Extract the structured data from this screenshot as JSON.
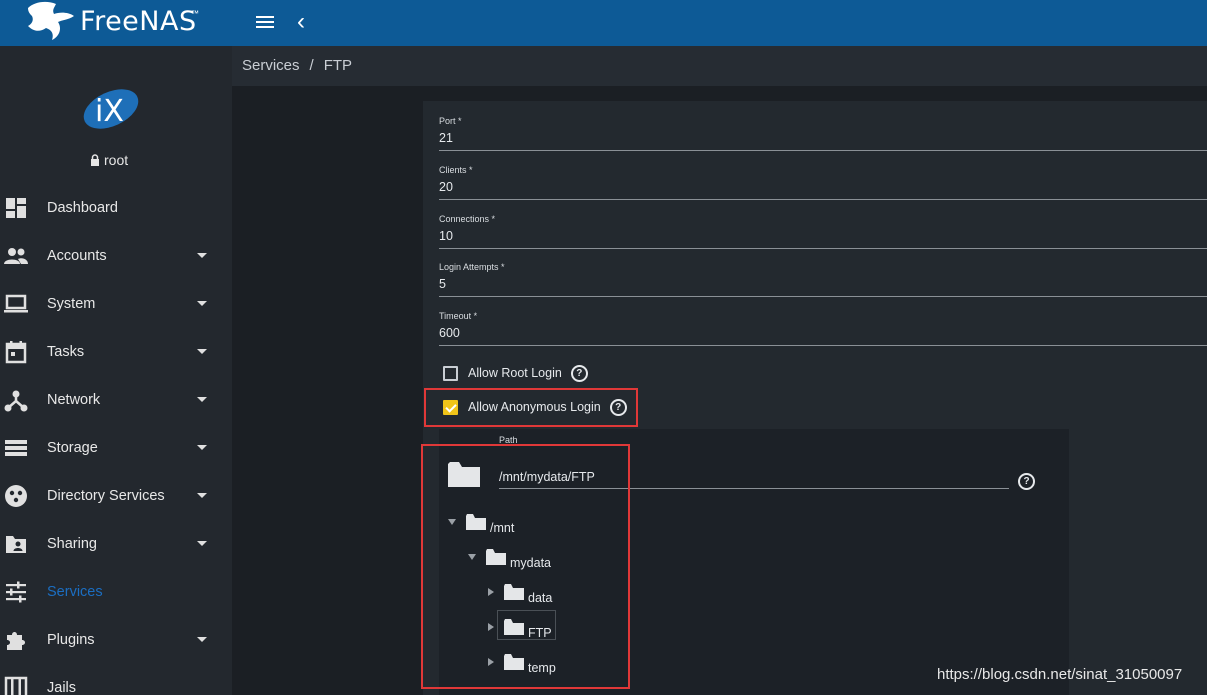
{
  "app": {
    "brand": "FreeNAS",
    "trademark": "™"
  },
  "user": {
    "name": "root"
  },
  "breadcrumb": {
    "parent": "Services",
    "separator": "/",
    "current": "FTP"
  },
  "sidebar": {
    "items": [
      {
        "label": "Dashboard",
        "icon": "dashboard-icon",
        "expandable": false
      },
      {
        "label": "Accounts",
        "icon": "people-icon",
        "expandable": true
      },
      {
        "label": "System",
        "icon": "laptop-icon",
        "expandable": true
      },
      {
        "label": "Tasks",
        "icon": "calendar-icon",
        "expandable": true
      },
      {
        "label": "Network",
        "icon": "network-icon",
        "expandable": true
      },
      {
        "label": "Storage",
        "icon": "storage-icon",
        "expandable": true
      },
      {
        "label": "Directory Services",
        "icon": "directory-icon",
        "expandable": true
      },
      {
        "label": "Sharing",
        "icon": "sharing-icon",
        "expandable": true
      },
      {
        "label": "Services",
        "icon": "tune-icon",
        "expandable": false,
        "active": true
      },
      {
        "label": "Plugins",
        "icon": "puzzle-icon",
        "expandable": true
      },
      {
        "label": "Jails",
        "icon": "jail-icon",
        "expandable": false
      }
    ]
  },
  "form": {
    "fields": [
      {
        "label": "Port *",
        "value": "21"
      },
      {
        "label": "Clients *",
        "value": "20"
      },
      {
        "label": "Connections *",
        "value": "10"
      },
      {
        "label": "Login Attempts *",
        "value": "5"
      },
      {
        "label": "Timeout *",
        "value": "600"
      }
    ],
    "allow_root_login": {
      "label": "Allow Root Login",
      "checked": false
    },
    "allow_anonymous_login": {
      "label": "Allow Anonymous Login",
      "checked": true
    },
    "help_glyph": "?"
  },
  "path": {
    "label": "Path",
    "value": "/mnt/mydata/FTP",
    "tree": [
      {
        "label": "/mnt",
        "expanded": true
      },
      {
        "label": "mydata",
        "expanded": true
      },
      {
        "label": "data",
        "expanded": false
      },
      {
        "label": "FTP",
        "expanded": false,
        "selected": true
      },
      {
        "label": "temp",
        "expanded": false
      }
    ]
  },
  "colors": {
    "topbar": "#0d5a96",
    "sidebar": "#23282e",
    "accent": "#1b6ec2",
    "checkbox_checked": "#f0c419",
    "highlight_box": "#e03838"
  },
  "watermark": "https://blog.csdn.net/sinat_31050097"
}
